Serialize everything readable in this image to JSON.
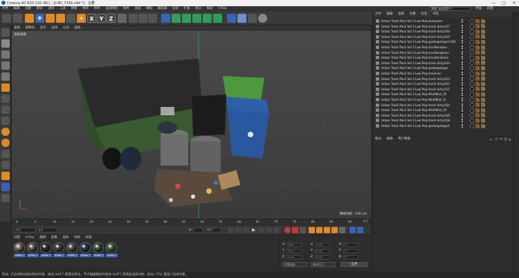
{
  "window": {
    "title": "Cinema 4D R23.110 (RC) - [C4D_7316.c4d *] - 主要",
    "controls": [
      "—",
      "□",
      "✕"
    ]
  },
  "menu": {
    "items": [
      "文件",
      "编辑",
      "创建",
      "模式",
      "选择",
      "工具",
      "网格",
      "样条",
      "体积",
      "运动图形",
      "角色",
      "动画",
      "模拟",
      "跟踪器",
      "渲染",
      "扩展",
      "窗口",
      "帮助",
      "V-Ray"
    ],
    "layout_label": "界面: 启动(用户)",
    "right_tabs": [
      "界面",
      "新建"
    ]
  },
  "toolbar": {
    "axis_labels": [
      "X",
      "Y",
      "Z"
    ]
  },
  "viewport": {
    "menu": [
      "查看",
      "摄像机",
      "显示",
      "选项",
      "过滤",
      "面板"
    ],
    "label": "透视视图",
    "grid_scale": "网格间距 : 100 cm"
  },
  "timeline": {
    "ticks": [
      "0",
      "5",
      "10",
      "15",
      "20",
      "25",
      "30",
      "35",
      "40",
      "45",
      "50",
      "55",
      "60",
      "65",
      "70",
      "75",
      "80",
      "85",
      "90"
    ],
    "frame_label": "0 F",
    "start_field": "0 F",
    "current_field": "0 F",
    "end_field": "90 F",
    "end_field2": "90 F"
  },
  "materials": {
    "tabs": [
      "创建",
      "V-Ray",
      "编辑",
      "查看",
      "选择",
      "材质",
      "纹理"
    ],
    "items": [
      {
        "label": "Urban T",
        "color": "#8c7a63"
      },
      {
        "label": "Urban T",
        "color": "#6b5f52"
      },
      {
        "label": "Urban T",
        "color": "#2e2e2e"
      },
      {
        "label": "Urban T",
        "color": "#3b4a3b"
      },
      {
        "label": "Urban T",
        "color": "#565656"
      },
      {
        "label": "Urban T",
        "color": "#2f3f5a"
      },
      {
        "label": "Urban T",
        "color": "#3f5a3a"
      },
      {
        "label": "Urban T",
        "color": "#4a6b3e"
      }
    ]
  },
  "coordinates": {
    "labels": [
      "X",
      "Y",
      "Z",
      "X",
      "Y",
      "Z",
      "H",
      "P",
      "B"
    ],
    "values": [
      "0 cm",
      "0 cm",
      "0 cm",
      "0 cm",
      "0 cm",
      "0 cm",
      "0 °",
      "0 °",
      "0 °"
    ],
    "mode_select": "世界坐标",
    "scale_select": "绝对尺寸",
    "apply_label": "应用"
  },
  "object_manager": {
    "tabs": [
      "文件",
      "编辑",
      "查看",
      "对象",
      "标签",
      "书签"
    ],
    "objects": [
      "Urban Trash Pack Vol 3 Low Poly-dumpster",
      "Urban Trash Pack Vol 3 Low Poly-trash dirty.027",
      "Urban Trash Pack Vol 3 Low Poly-trash dirty.026",
      "Urban Trash Pack Vol 3 Low Poly-trash dirty.025",
      "Urban Trash Pack Vol 3 Low Poly-garbagebags2.001",
      "Urban Trash Pack Vol 3 Low Poly-trashbinblue",
      "Urban Trash Pack Vol 3 Low Poly-trashbingreen",
      "Urban Trash Pack Vol 3 Low Poly-trashbinblack",
      "Urban Trash Pack Vol 3 Low Poly-trash dirty.024",
      "Urban Trash Pack Vol 3 Low Poly-garbagebags",
      "Urban Trash Pack Vol 3 Low Poly-trashcan",
      "Urban Trash Pack Vol 3 Low Poly-trash dirty.023",
      "Urban Trash Pack Vol 3 Low Poly-trash dirty.022",
      "Urban Trash Pack Vol 3 Low Poly-trash dirty.021",
      "Urban Trash Pack Vol 3 Low Poly-MultiMat_10",
      "Urban Trash Pack Vol 3 Low Poly-MultiMat_11",
      "Urban Trash Pack Vol 3 Low Poly-trash dirty.020",
      "Urban Trash Pack Vol 3 Low Poly-MultiMat_19",
      "Urban Trash Pack Vol 3 Low Poly-trash dirty.019",
      "Urban Trash Pack Vol 3 Low Poly-trash dirty.018",
      "Urban Trash Pack Vol 3 Low Poly-garbagebags2"
    ]
  },
  "attribute_manager": {
    "tabs": [
      "模式",
      "编辑",
      "用户数据"
    ],
    "nav": "← ↑ ↷ ⚲ ⌂ ▣"
  },
  "status": {
    "text": "移动: 点击并拖动鼠标移动元素。按住 SHIFT 键量化移动；节点编辑模式时按住 SHIFT 键增加选择对象；按住 CTRL 键减少选择对象。"
  },
  "colors": {
    "toolbar_blue": "#3a63b5",
    "accent_orange": "#e08a20",
    "accent_green": "#2e9e5a"
  }
}
